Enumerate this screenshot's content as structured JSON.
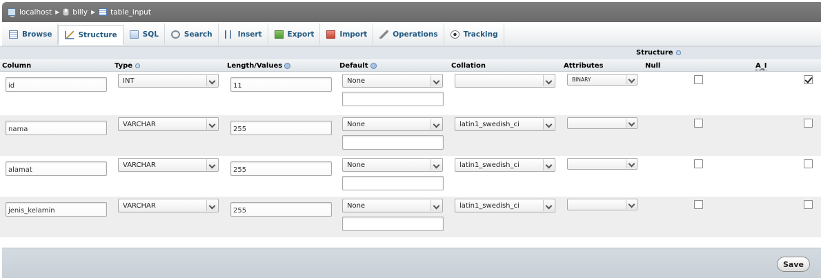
{
  "breadcrumb": [
    {
      "label": "localhost",
      "icon": "server-icon"
    },
    {
      "label": "billy",
      "icon": "database-icon"
    },
    {
      "label": "table_input",
      "icon": "table-icon"
    }
  ],
  "tabs": [
    {
      "label": "Browse",
      "icon": "browse-icon"
    },
    {
      "label": "Structure",
      "icon": "structure-icon",
      "active": true
    },
    {
      "label": "SQL",
      "icon": "sql-icon"
    },
    {
      "label": "Search",
      "icon": "search-icon"
    },
    {
      "label": "Insert",
      "icon": "insert-icon"
    },
    {
      "label": "Export",
      "icon": "export-icon"
    },
    {
      "label": "Import",
      "icon": "import-icon"
    },
    {
      "label": "Operations",
      "icon": "operations-icon"
    },
    {
      "label": "Tracking",
      "icon": "tracking-icon"
    }
  ],
  "structure_label": "Structure",
  "headers": {
    "column": "Column",
    "type": "Type",
    "length": "Length/Values",
    "default": "Default",
    "collation": "Collation",
    "attributes": "Attributes",
    "null": "Null",
    "ai": "A_I"
  },
  "rows": [
    {
      "column": "id",
      "type": "INT",
      "length": "11",
      "default": "None",
      "collation": "",
      "attributes": "BINARY",
      "null": false,
      "ai": true
    },
    {
      "column": "nama",
      "type": "VARCHAR",
      "length": "255",
      "default": "None",
      "collation": "latin1_swedish_ci",
      "attributes": "",
      "null": false,
      "ai": false
    },
    {
      "column": "alamat",
      "type": "VARCHAR",
      "length": "255",
      "default": "None",
      "collation": "latin1_swedish_ci",
      "attributes": "",
      "null": false,
      "ai": false
    },
    {
      "column": "jenis_kelamin",
      "type": "VARCHAR",
      "length": "255",
      "default": "None",
      "collation": "latin1_swedish_ci",
      "attributes": "",
      "null": false,
      "ai": false
    }
  ],
  "save_label": "Save"
}
